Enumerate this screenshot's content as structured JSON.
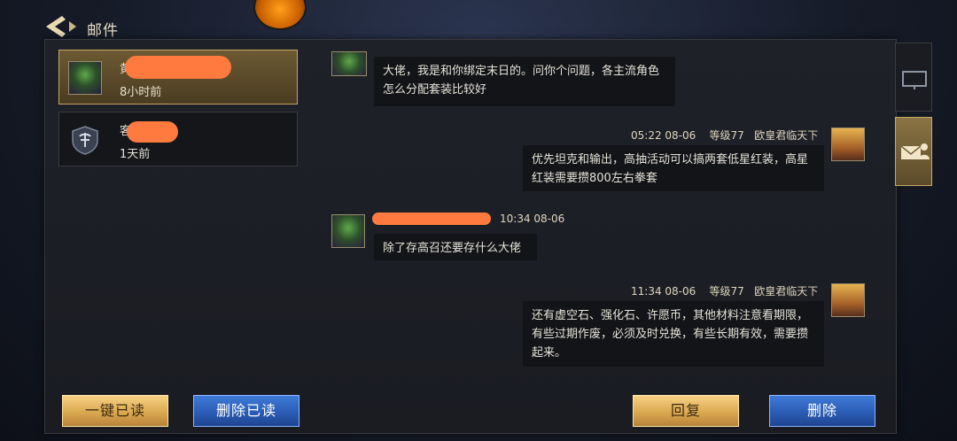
{
  "header": {
    "title": "邮件"
  },
  "mail_list": [
    {
      "name": "黄",
      "time": "8小时前",
      "selected": true
    },
    {
      "name": "客",
      "time": "1天前",
      "selected": false
    }
  ],
  "messages": [
    {
      "side": "left",
      "meta": "",
      "text": "大佬，我是和你绑定末日的。问你个问题，各主流角色怎么分配套装比较好"
    },
    {
      "side": "right",
      "time": "05:22  08-06",
      "level": "等级77",
      "sender": "欧皇君临天下",
      "text": "优先坦克和输出，高抽活动可以搞两套低星红装，高星红装需要攒800左右拳套"
    },
    {
      "side": "left",
      "time": "10:34  08-06",
      "text": "除了存高召还要存什么大佬"
    },
    {
      "side": "right",
      "time": "11:34  08-06",
      "level": "等级77",
      "sender": "欧皇君临天下",
      "text": "还有虚空石、强化石、许愿币，其他材料注意看期限，有些过期作废，必须及时兑换，有些长期有效，需要攒起来。"
    }
  ],
  "buttons": {
    "read_all": "一键已读",
    "delete_read": "删除已读",
    "reply": "回复",
    "delete": "删除"
  },
  "colors": {
    "gold": "#dba851",
    "blue": "#2b5db5",
    "redact": "#ff7a3f"
  }
}
